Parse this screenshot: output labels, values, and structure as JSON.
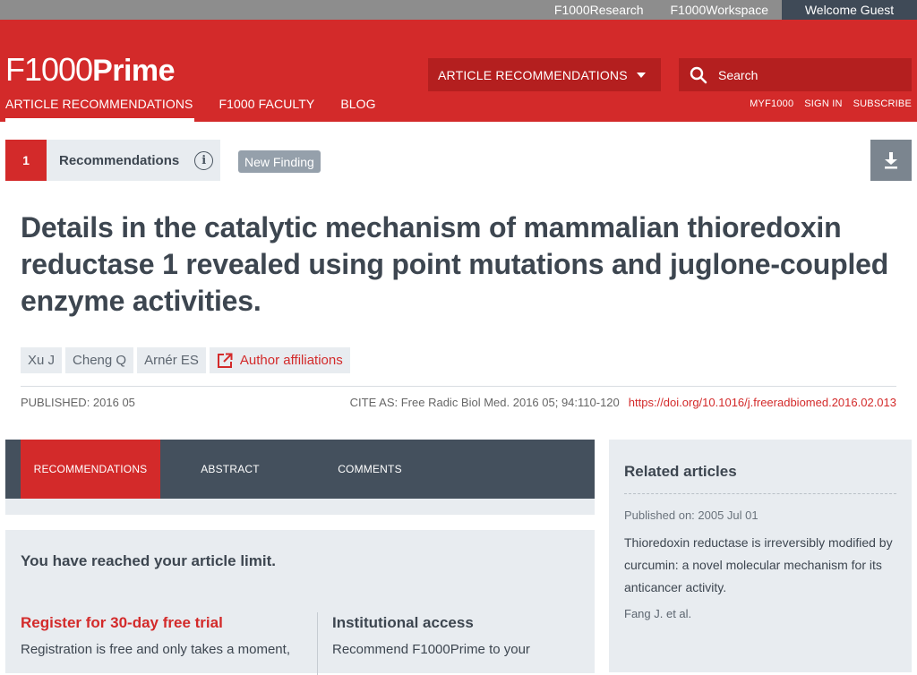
{
  "topbar": {
    "links": [
      "F1000Research",
      "F1000Workspace"
    ],
    "welcome": "Welcome Guest"
  },
  "header": {
    "logo_f1000": "F1000",
    "logo_prime": "Prime",
    "select_value": "ARTICLE RECOMMENDATIONS",
    "search_placeholder": "Search"
  },
  "nav": {
    "items": [
      "ARTICLE RECOMMENDATIONS",
      "F1000 FACULTY",
      "BLOG"
    ],
    "right": [
      "MYF1000",
      "SIGN IN",
      "SUBSCRIBE"
    ]
  },
  "recommendations": {
    "count": "1",
    "label": "Recommendations",
    "badge": "New Finding"
  },
  "article": {
    "title": "Details in the catalytic mechanism of mammalian thioredoxin reductase 1 revealed using point mutations and juglone-coupled enzyme activities.",
    "authors": [
      "Xu J",
      "Cheng Q",
      "Arnér ES"
    ],
    "affiliations_label": "Author affiliations",
    "published": "PUBLISHED: 2016 05",
    "cite_as": "CITE AS: Free Radic Biol Med. 2016 05; 94:110-120",
    "doi": "https://doi.org/10.1016/j.freeradbiomed.2016.02.013"
  },
  "tabs": [
    "RECOMMENDATIONS",
    "ABSTRACT",
    "COMMENTS"
  ],
  "limit": {
    "heading": "You have reached your article limit.",
    "register_title": "Register for 30-day free trial",
    "register_text": "Registration is free and only takes a moment,",
    "institution_title": "Institutional access",
    "institution_text": "Recommend F1000Prime to your"
  },
  "related": {
    "heading": "Related articles",
    "published": "Published on: 2005 Jul 01",
    "title": "Thioredoxin reductase is irreversibly modified by curcumin: a novel molecular mechanism for its anticancer activity.",
    "authors": "Fang J. et al."
  },
  "colors": {
    "brand_red": "#d32a2a",
    "dark_slate": "#44505d",
    "panel_grey": "#e8ecf0"
  }
}
